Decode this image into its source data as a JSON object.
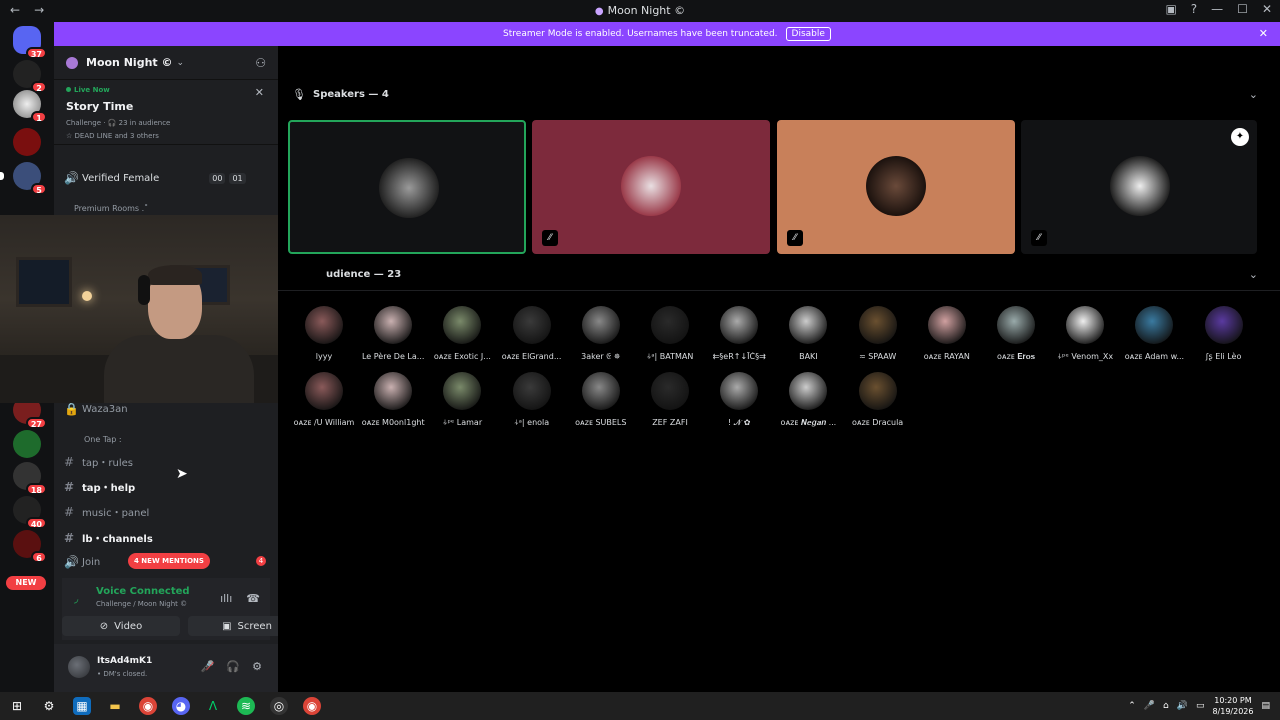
{
  "window": {
    "title": "Moon Night ©"
  },
  "banner": {
    "text": "Streamer Mode is enabled. Usernames have been truncated.",
    "disable": "Disable"
  },
  "rail": {
    "badges": [
      "37",
      "2",
      "1",
      "5",
      "27",
      "18",
      "40",
      "6"
    ],
    "new_label": "NEW"
  },
  "server": {
    "name": "Moon Night ©"
  },
  "live": {
    "tag": "Live Now",
    "title": "Story Time",
    "meta": "Challenge · 🎧 23 in audience",
    "members": "☆ DEAD LINE  and 3 others"
  },
  "channels": {
    "verified_female": "Verified Female",
    "vf_counts": [
      "00",
      "01"
    ],
    "premium_rooms": "Premium Rooms .˚",
    "waza": "Waza3an",
    "one_tap": "One Tap :",
    "tap_rules": "tap・rules",
    "tap_help": "tap・help",
    "music_panel": "music・panel",
    "lb_channels": "lb・channels",
    "join": "Join",
    "new_mentions": "4 NEW MENTIONS",
    "mention_count": "4"
  },
  "voice": {
    "status": "Voice Connected",
    "sub": "Challenge / Moon Night ©",
    "video": "Video",
    "screen": "Screen"
  },
  "user": {
    "name": "ItsAd4mK1",
    "status": "• DM's closed."
  },
  "stage": {
    "speakers_title": "Speakers — 4",
    "audience_title": "udience — 23",
    "audience_row1": [
      "lyyy",
      "Le Père De La...",
      "ᴏᴀᴢᴇ Exotic J...",
      "ᴏᴀᴢᴇ ElGrand...",
      "3aker 𝔈 ✵",
      "⍭ᵃ| BATMAN",
      "⇇§eR↑↓ĪČ§⇉",
      "BAKI",
      "≂ SPAAW",
      "ᴏᴀᴢᴇ RAYAN",
      "ᴏᴀᴢᴇ 𝐄𝐫𝐨𝐬",
      "⍭ᵖᵉ Venom_Xx",
      "ᴏᴀᴢᴇ Adam w...",
      "ʃʂ Eli Lèo"
    ],
    "audience_row2": [
      "ᴏᴀᴢᴇ /U William",
      "ᴏᴀᴢᴇ M0onl1ght",
      "⍭ᵖᵉ Lamar",
      "⍭ᵃ| enola",
      "ᴏᴀᴢᴇ SUBELS",
      "ZEF ZAFI",
      "! 𝓝 ✿",
      "ᴏᴀᴢᴇ 𝑵𝒆𝒈𝒂𝒏 ...",
      "ᴏᴀᴢᴇ Dracula"
    ]
  },
  "taskbar": {
    "time": "10:20 PM",
    "date": "8/19/2026"
  },
  "colors": {
    "accent": "#8b45ff",
    "green": "#23a55a",
    "red": "#f23f43"
  }
}
